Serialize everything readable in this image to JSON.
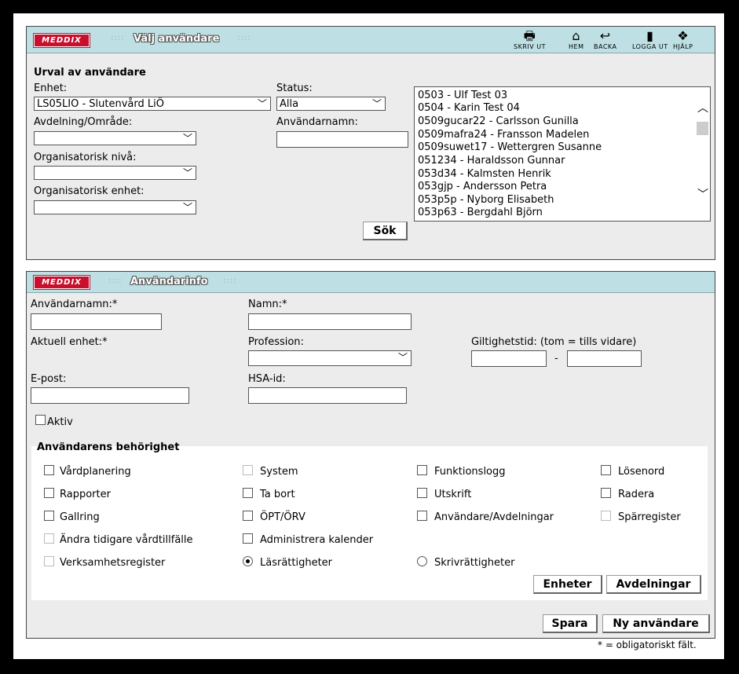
{
  "brand": "MEDDIX",
  "search_panel": {
    "title": "Välj användare",
    "toolbar": [
      {
        "icon": "printer-icon",
        "label": "SKRIV UT"
      },
      {
        "icon": "home-icon",
        "label": "HEM"
      },
      {
        "icon": "back-icon",
        "label": "BACKA"
      },
      {
        "icon": "logout-icon",
        "label": "LOGGA UT"
      },
      {
        "icon": "help-icon",
        "label": "HJÄLP"
      }
    ],
    "heading": "Urval av användare",
    "enhet_label": "Enhet:",
    "enhet_value": "LS05LIO - Slutenvård LiÖ",
    "status_label": "Status:",
    "status_value": "Alla",
    "avdelning_label": "Avdelning/Område:",
    "anvandarnamn_label": "Användarnamn:",
    "org_niva_label": "Organisatorisk nivå:",
    "org_enhet_label": "Organisatorisk enhet:",
    "search_button": "Sök",
    "users": [
      "0503 - Ulf Test 03",
      "0504 - Karin Test 04",
      "0509gucar22 - Carlsson Gunilla",
      "0509mafra24 - Fransson Madelen",
      "0509suwet17 - Wettergren Susanne",
      "051234 - Haraldsson Gunnar",
      "053d34 - Kalmsten Henrik",
      "053gjp - Andersson Petra",
      "053p5p - Nyborg Elisabeth",
      "053p63 - Bergdahl Björn"
    ]
  },
  "info_panel": {
    "title": "Användarinfo",
    "anvandarnamn_label": "Användarnamn:*",
    "namn_label": "Namn:*",
    "aktuell_enhet_label": "Aktuell enhet:*",
    "profession_label": "Profession:",
    "giltighet_label": "Giltighetstid: (tom = tills vidare)",
    "giltighet_sep": "-",
    "epost_label": "E-post:",
    "hsa_label": "HSA-id:",
    "aktiv_label": "Aktiv",
    "perm_heading": "Användarens behörighet",
    "permissions": {
      "vardplanering": "Vårdplanering",
      "system": "System",
      "funktionslogg": "Funktionslogg",
      "losenord": "Lösenord",
      "rapporter": "Rapporter",
      "ta_bort": "Ta bort",
      "utskrift": "Utskrift",
      "radera": "Radera",
      "gallring": "Gallring",
      "opt_orv": "ÖPT/ÖRV",
      "anvandare_avd": "Användare/Avdelningar",
      "sparregister": "Spärregister",
      "andra_tidigare": "Ändra tidigare vårdtillfälle",
      "admin_kalender": "Administrera kalender",
      "verksamhetsregister": "Verksamhetsregister",
      "lasrattigheter": "Läsrättigheter",
      "skrivrattigheter": "Skrivrättigheter"
    },
    "enheter_button": "Enheter",
    "avdelningar_button": "Avdelningar",
    "spara_button": "Spara",
    "ny_button": "Ny användare"
  },
  "footnote": "* = obligatoriskt fält."
}
